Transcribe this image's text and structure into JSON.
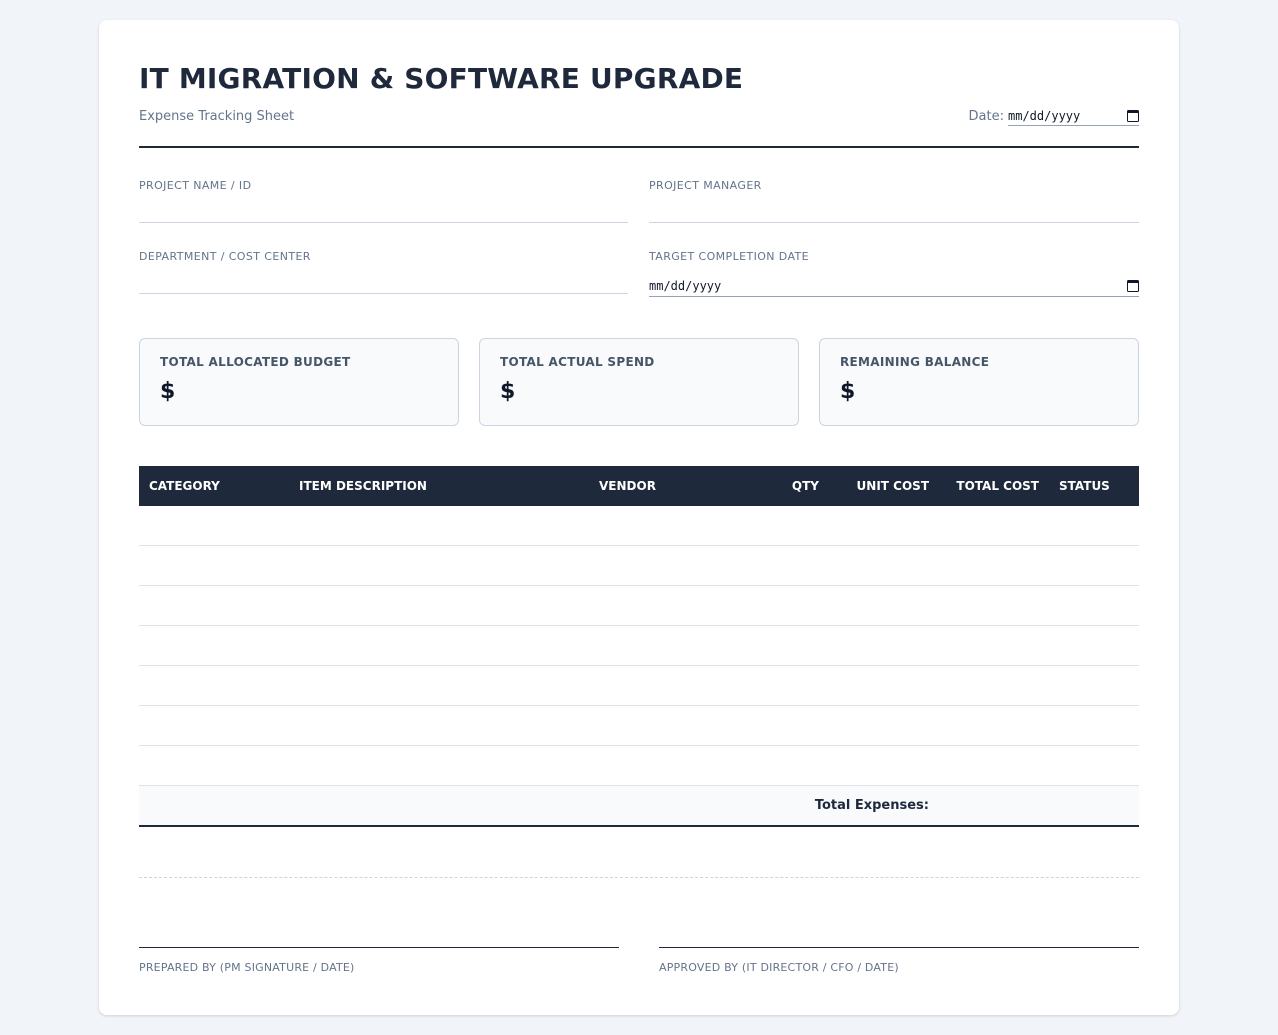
{
  "header": {
    "title": "IT MIGRATION & SOFTWARE UPGRADE",
    "subtitle": "Expense Tracking Sheet",
    "date_label": "Date:",
    "date_placeholder": "mm/dd/yyyy"
  },
  "fields": {
    "project_name_label": "PROJECT NAME / ID",
    "project_manager_label": "PROJECT MANAGER",
    "department_label": "DEPARTMENT / COST CENTER",
    "target_date_label": "TARGET COMPLETION DATE",
    "target_date_placeholder": "mm/dd/yyyy"
  },
  "summary": [
    {
      "label": "TOTAL ALLOCATED BUDGET",
      "value": "$"
    },
    {
      "label": "TOTAL ACTUAL SPEND",
      "value": "$"
    },
    {
      "label": "REMAINING BALANCE",
      "value": "$"
    }
  ],
  "table": {
    "columns": [
      "CATEGORY",
      "ITEM DESCRIPTION",
      "VENDOR",
      "QTY",
      "UNIT COST",
      "TOTAL COST",
      "STATUS"
    ],
    "footer_label": "Total Expenses:"
  },
  "signatures": {
    "prepared_by": "PREPARED BY (PM SIGNATURE / DATE)",
    "approved_by": "APPROVED BY (IT DIRECTOR / CFO / DATE)"
  },
  "icons": {
    "date_icon": "calendar-icon"
  },
  "colors": {
    "dark": "#1e293b",
    "muted": "#64748b",
    "background": "#f1f4f8"
  }
}
